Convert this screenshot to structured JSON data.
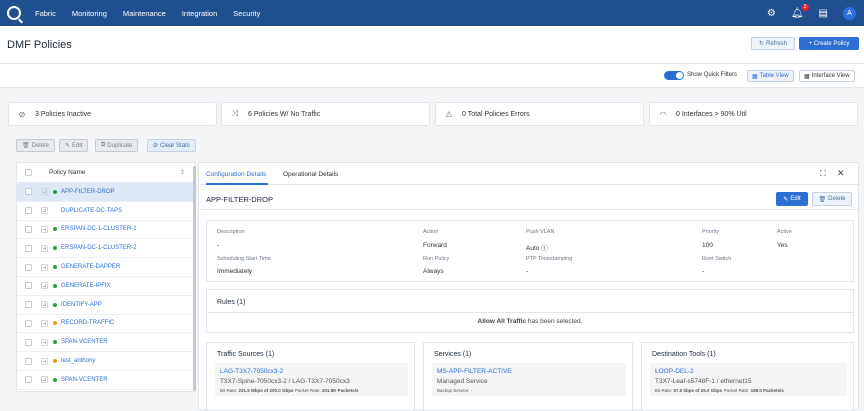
{
  "nav": {
    "items": [
      "Fabric",
      "Monitoring",
      "Maintenance",
      "Integration",
      "Security"
    ],
    "notification_count": "2",
    "avatar_initial": "A"
  },
  "header": {
    "title": "DMF Policies",
    "refresh_label": "Refresh",
    "create_label": "+ Create Policy"
  },
  "viewbar": {
    "quick_filters_label": "Show Quick Filters",
    "table_view_label": "Table View",
    "interface_view_label": "Interface View"
  },
  "stats": {
    "inactive": "3 Policies Inactive",
    "no_traffic": "6 Policies W/ No Traffic",
    "errors": "0 Total Policies Errors",
    "interfaces": "0 Interfaces > 90% Util"
  },
  "toolbar": {
    "delete_label": "Delete",
    "edit_label": "Edit",
    "duplicate_label": "Duplicate",
    "clear_stats_label": "Clear Stats"
  },
  "policy_list": {
    "column_header": "Policy Name",
    "colors": {
      "green": "#2e9e3e",
      "amber": "#e0a21a"
    },
    "rows": [
      {
        "name": "APP-FILTER-DROP",
        "status": "green",
        "selected": true
      },
      {
        "name": "DUPLICATE-DC-TAPS",
        "status": "none"
      },
      {
        "name": "ERSPAN-DC-1-CLUSTER-1",
        "status": "green"
      },
      {
        "name": "ERSPAN-DC-1-CLUSTER-2",
        "status": "green"
      },
      {
        "name": "GENERATE-DAPPER",
        "status": "green"
      },
      {
        "name": "GENERATE-IPFIX",
        "status": "green"
      },
      {
        "name": "IDENTIFY-APP",
        "status": "green"
      },
      {
        "name": "RECORD-TRAFFIC",
        "status": "amber"
      },
      {
        "name": "SPAN-VCENTER",
        "status": "green"
      },
      {
        "name": "test_anthony",
        "status": "amber"
      },
      {
        "name": "SPAN-VCENTER",
        "status": "green"
      }
    ]
  },
  "details": {
    "tabs": [
      "Configuration Details",
      "Operational Details"
    ],
    "policy_name": "APP-FILTER-DROP",
    "edit_label": "Edit",
    "delete_label": "Delete",
    "fields": {
      "description_label": "Description",
      "description_value": "-",
      "action_label": "Action",
      "action_value": "Forward",
      "push_vlan_label": "Push VLAN",
      "push_vlan_value": "Auto",
      "priority_label": "Priority",
      "priority_value": "100",
      "active_label": "Active",
      "active_value": "Yes",
      "sched_label": "Scheduling Start Time",
      "sched_value": "Immediately",
      "run_label": "Run Policy",
      "run_value": "Always",
      "ptp_label": "PTP Timestamping",
      "ptp_value": "-",
      "root_label": "Root Switch",
      "root_value": "-"
    },
    "rules": {
      "title": "Rules (1)",
      "text_bold": "Allow All Traffic",
      "text_rest": " has been selected."
    },
    "traffic_sources": {
      "title": "Traffic Sources (1)",
      "link": "LAG-T3X7-7050cx3-2",
      "sub": "T3X7-Spine-7050cx3-2 / LAG-T3X7-7050cx3",
      "rate_label": "Bit Rate:",
      "rate_value": "231.5 Mbps of 200.0 Gbps",
      "pkt_label": "Packet Rate:",
      "pkt_value": "201.5K Packets/s"
    },
    "services": {
      "title": "Services (1)",
      "link": "MS-APP-FILTER-ACTIVE",
      "sub": "Managed Service",
      "backup": "Backup Service: -"
    },
    "tools": {
      "title": "Destination Tools (1)",
      "link": "LOOP-DEL-2",
      "sub": "T3X7-Leaf-s5748F-1 / ethernet15",
      "rate_label": "Bit Rate:",
      "rate_value": "97.0 kbps of 25.0 Gbps",
      "pkt_label": "Packet Rate:",
      "pkt_value": "198.0 Packets/s"
    }
  }
}
